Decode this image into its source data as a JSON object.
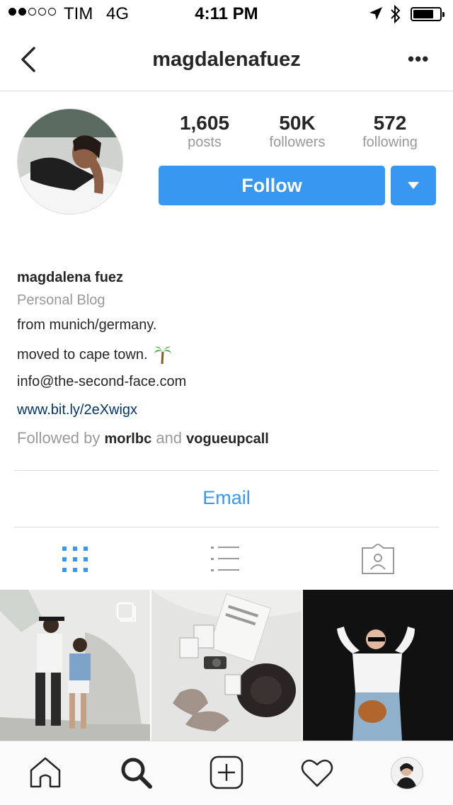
{
  "status_bar": {
    "carrier": "TIM",
    "network": "4G",
    "time": "4:11 PM",
    "signal_bars_filled": 2,
    "signal_bars_total": 5,
    "battery_level": 0.7
  },
  "nav": {
    "username": "magdalenafuez",
    "back_icon": "chevron-left-icon",
    "more_icon": "ellipsis-icon",
    "more_label": "•••"
  },
  "profile": {
    "stats": [
      {
        "value": "1,605",
        "label": "posts"
      },
      {
        "value": "50K",
        "label": "followers"
      },
      {
        "value": "572",
        "label": "following"
      }
    ],
    "follow_label": "Follow",
    "full_name": "magdalena fuez",
    "category": "Personal Blog",
    "bio_line_1": "from munich/germany.",
    "bio_line_2": "moved to cape town.",
    "bio_line_3": "info@the-second-face.com",
    "website": "www.bit.ly/2eXwigx",
    "followed_by_prefix": "Followed by",
    "followed_by_user_1": "morlbc",
    "followed_by_and": "and",
    "followed_by_user_2": "vogueupcall",
    "email_label": "Email"
  },
  "view_tabs": [
    {
      "icon": "grid-icon",
      "active": true
    },
    {
      "icon": "list-icon",
      "active": false
    },
    {
      "icon": "tagged-icon",
      "active": false
    }
  ],
  "bottom_tabs": [
    {
      "icon": "home-icon"
    },
    {
      "icon": "search-icon",
      "active": true
    },
    {
      "icon": "add-post-icon"
    },
    {
      "icon": "heart-icon"
    },
    {
      "icon": "profile-avatar"
    }
  ],
  "colors": {
    "accent": "#3897f0",
    "link": "#003569",
    "muted": "#999999",
    "divider": "#dbdbdb"
  }
}
